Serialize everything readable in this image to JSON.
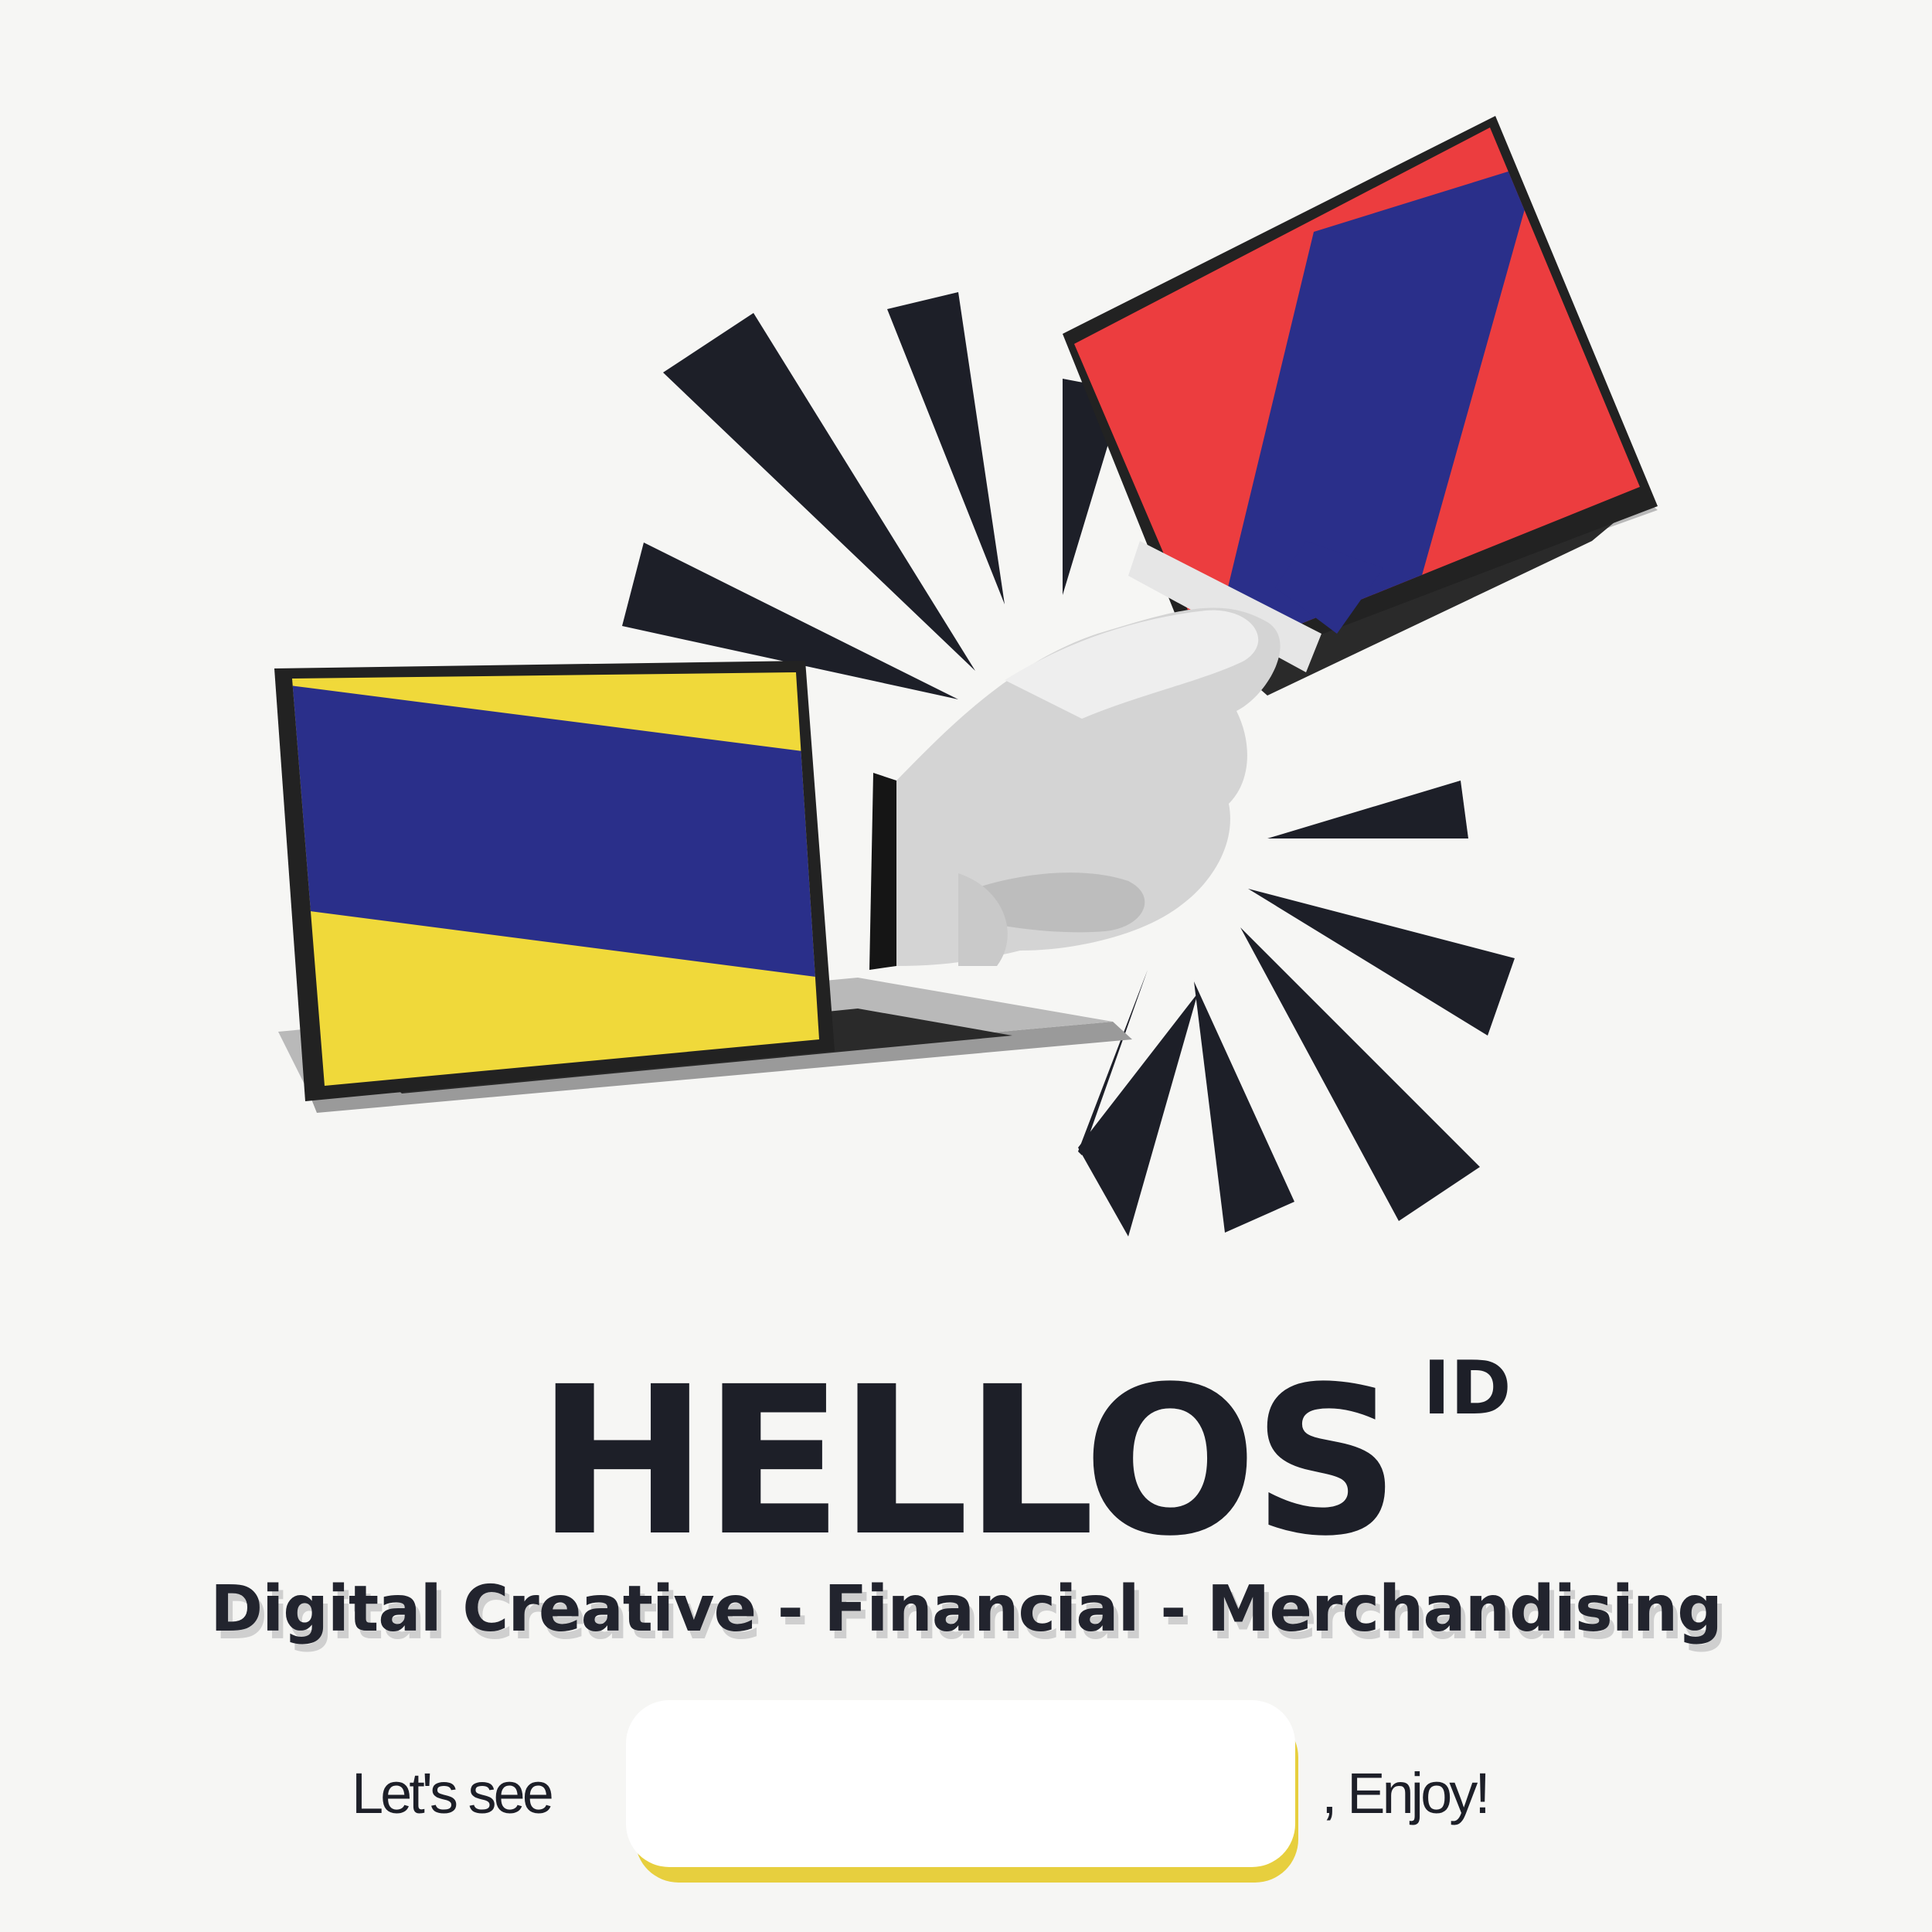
{
  "brand": {
    "name": "HELLOS",
    "superscript": "ID"
  },
  "tagline": "Digital Creative - Financial - Merchandising",
  "cta": {
    "prefix": "Let's see",
    "input_value": "",
    "suffix": ", Enjoy!"
  },
  "colors": {
    "background": "#f6f6f4",
    "ink": "#1d1f28",
    "sleeve_blue": "#2a2f8a",
    "screen_yellow": "#f0d93a",
    "screen_red": "#ec3d3f",
    "input_shadow": "#e7cf3e"
  },
  "illustration": {
    "subject": "handshake-between-laptops",
    "icons": [
      "laptop-left",
      "laptop-right",
      "handshake",
      "burst-rays"
    ]
  }
}
